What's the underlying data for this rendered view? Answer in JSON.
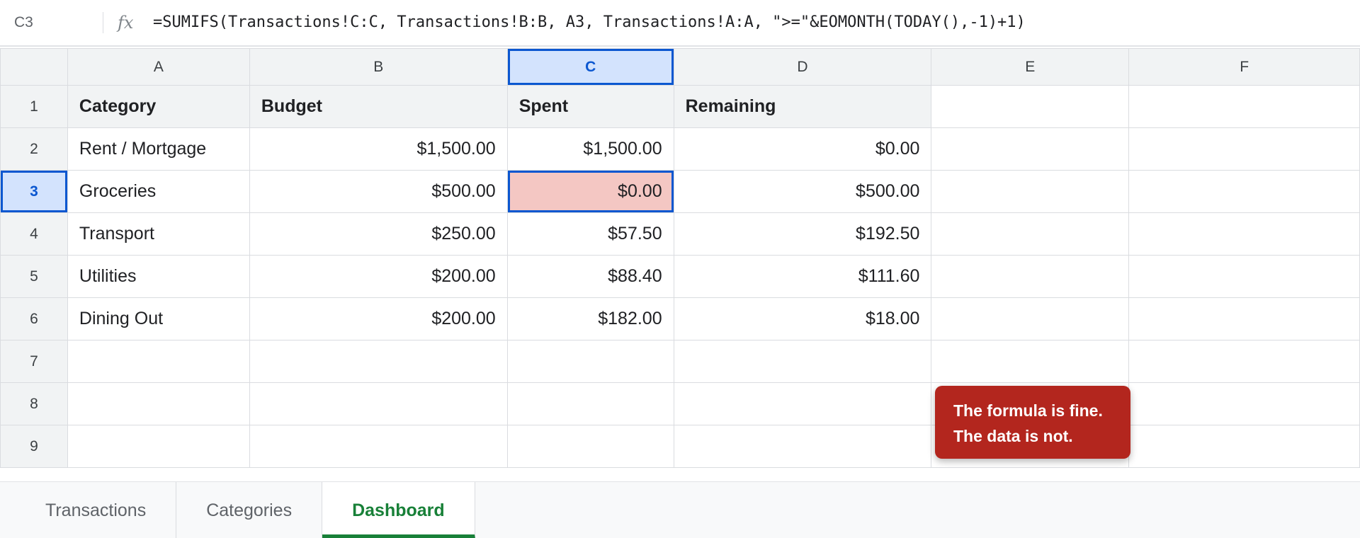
{
  "formula_bar": {
    "cell_ref": "C3",
    "fx_label": "fx",
    "formula": "=SUMIFS(Transactions!C:C, Transactions!B:B, A3, Transactions!A:A, \">=\"&EOMONTH(TODAY(),-1)+1)"
  },
  "grid": {
    "columns": [
      "A",
      "B",
      "C",
      "D",
      "E",
      "F"
    ],
    "active_column": "C",
    "active_row": "3",
    "rows": [
      {
        "num": "1",
        "cells": [
          "Category",
          "Budget",
          "Spent",
          "Remaining",
          "",
          ""
        ]
      },
      {
        "num": "2",
        "cells": [
          "Rent / Mortgage",
          "$1,500.00",
          "$1,500.00",
          "$0.00",
          "",
          ""
        ]
      },
      {
        "num": "3",
        "cells": [
          "Groceries",
          "$500.00",
          "$0.00",
          "$500.00",
          "",
          ""
        ]
      },
      {
        "num": "4",
        "cells": [
          "Transport",
          "$250.00",
          "$57.50",
          "$192.50",
          "",
          ""
        ]
      },
      {
        "num": "5",
        "cells": [
          "Utilities",
          "$200.00",
          "$88.40",
          "$111.60",
          "",
          ""
        ]
      },
      {
        "num": "6",
        "cells": [
          "Dining Out",
          "$200.00",
          "$182.00",
          "$18.00",
          "",
          ""
        ]
      },
      {
        "num": "7",
        "cells": [
          "",
          "",
          "",
          "",
          "",
          ""
        ]
      },
      {
        "num": "8",
        "cells": [
          "",
          "",
          "",
          "",
          "",
          ""
        ]
      },
      {
        "num": "9",
        "cells": [
          "",
          "",
          "",
          "",
          "",
          ""
        ]
      }
    ]
  },
  "callout": {
    "line1": "The formula is fine.",
    "line2": "The data is not.",
    "color": "#b3261e"
  },
  "sheet_tabs": [
    {
      "label": "Transactions",
      "active": false
    },
    {
      "label": "Categories",
      "active": false
    },
    {
      "label": "Dashboard",
      "active": true
    }
  ],
  "colors": {
    "selection": "#0b57d0",
    "selected_cell_fill": "#f4c7c3",
    "active_tab": "#188038"
  }
}
